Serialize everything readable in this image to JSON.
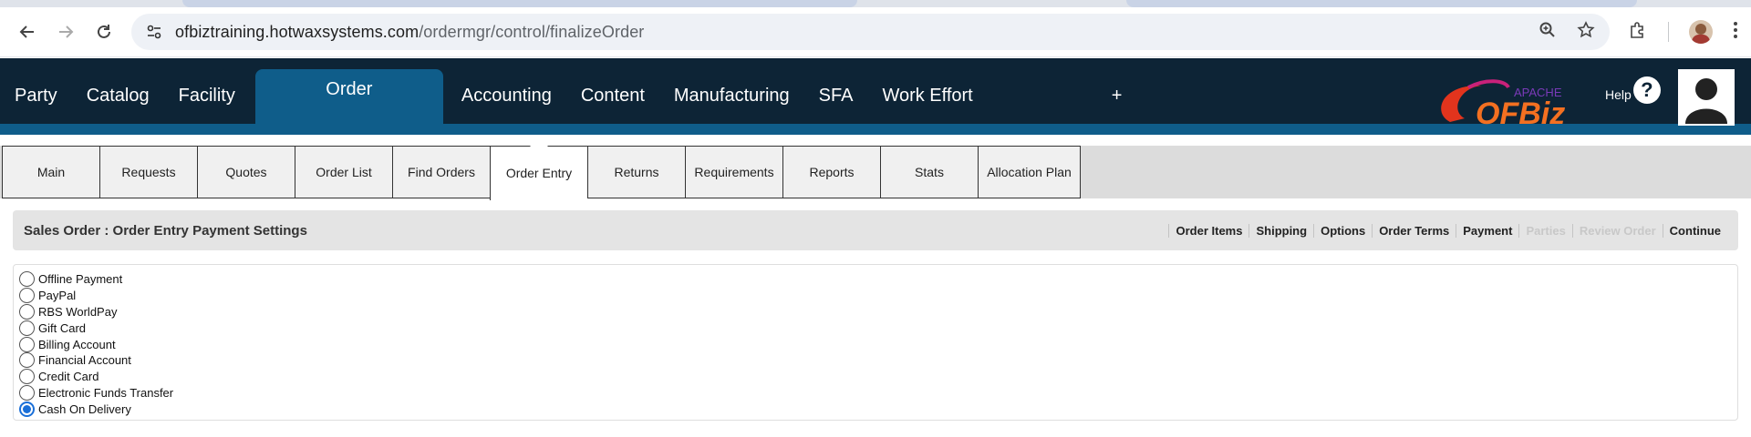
{
  "browser": {
    "url_host": "ofbiztraining.hotwaxsystems.com",
    "url_path": "/ordermgr/control/finalizeOrder"
  },
  "header": {
    "nav": [
      "Party",
      "Catalog",
      "Facility",
      "Order",
      "Accounting",
      "Content",
      "Manufacturing",
      "SFA",
      "Work Effort",
      "+"
    ],
    "active_nav": "Order",
    "logo_top": "APACHE",
    "logo_text": "OFBiz",
    "help_label": "Help",
    "help_icon_glyph": "?"
  },
  "subtabs": {
    "items": [
      "Main",
      "Requests",
      "Quotes",
      "Order List",
      "Find Orders",
      "Order Entry",
      "Returns",
      "Requirements",
      "Reports",
      "Stats",
      "Allocation Plan"
    ],
    "active": "Order Entry"
  },
  "screenlet": {
    "title": "Sales Order : Order Entry Payment Settings",
    "steps": [
      {
        "label": "Order Items",
        "enabled": true
      },
      {
        "label": "Shipping",
        "enabled": true
      },
      {
        "label": "Options",
        "enabled": true
      },
      {
        "label": "Order Terms",
        "enabled": true
      },
      {
        "label": "Payment",
        "enabled": true
      },
      {
        "label": "Parties",
        "enabled": false
      },
      {
        "label": "Review Order",
        "enabled": false
      },
      {
        "label": "Continue",
        "enabled": true
      }
    ]
  },
  "payment_options": [
    {
      "label": "Offline Payment",
      "checked": false
    },
    {
      "label": "PayPal",
      "checked": false
    },
    {
      "label": "RBS WorldPay",
      "checked": false
    },
    {
      "label": "Gift Card",
      "checked": false
    },
    {
      "label": "Billing Account",
      "checked": false
    },
    {
      "label": "Financial Account",
      "checked": false
    },
    {
      "label": "Credit Card",
      "checked": false
    },
    {
      "label": "Electronic Funds Transfer",
      "checked": false
    },
    {
      "label": "Cash On Delivery",
      "checked": true
    }
  ],
  "colors": {
    "header_bg": "#0d2436",
    "accent": "#0f5d8a",
    "radio_checked": "#1a6fd8"
  }
}
